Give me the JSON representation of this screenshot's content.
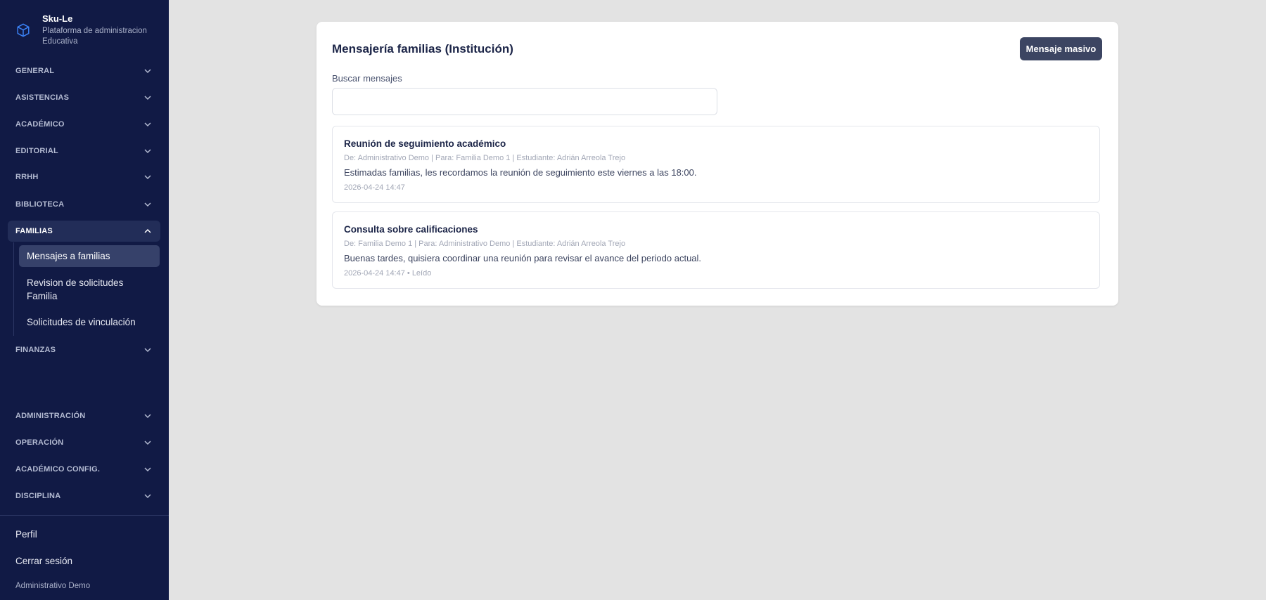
{
  "brand": {
    "title": "Sku-Le",
    "subtitle": "Plataforma de administracion Educativa",
    "icon": "cube-icon"
  },
  "sidebar": {
    "sections": [
      {
        "label": "GENERAL",
        "expanded": false
      },
      {
        "label": "ASISTENCIAS",
        "expanded": false
      },
      {
        "label": "ACADÉMICO",
        "expanded": false
      },
      {
        "label": "EDITORIAL",
        "expanded": false
      },
      {
        "label": "RRHH",
        "expanded": false
      },
      {
        "label": "BIBLIOTECA",
        "expanded": false
      },
      {
        "label": "FAMILIAS",
        "expanded": true
      },
      {
        "label": "FINANZAS",
        "expanded": false
      },
      {
        "label": "ADMINISTRACIÓN",
        "expanded": false
      },
      {
        "label": "OPERACIÓN",
        "expanded": false
      },
      {
        "label": "ACADÉMICO CONFIG.",
        "expanded": false
      },
      {
        "label": "DISCIPLINA",
        "expanded": false
      }
    ],
    "familias_items": [
      {
        "label": "Mensajes a familias",
        "active": true
      },
      {
        "label": "Revision de solicitudes Familia",
        "active": false
      },
      {
        "label": "Solicitudes de vinculación",
        "active": false
      }
    ],
    "footer": {
      "profile": "Perfil",
      "logout": "Cerrar sesión",
      "user": "Administrativo Demo"
    }
  },
  "main": {
    "title": "Mensajería familias (Institución)",
    "mass_button": "Mensaje masivo",
    "search_label": "Buscar mensajes",
    "search_value": "",
    "search_placeholder": "",
    "messages": [
      {
        "subject": "Reunión de seguimiento académico",
        "meta": "De: Administrativo Demo | Para: Familia Demo 1 | Estudiante: Adrián Arreola Trejo",
        "body": "Estimadas familias, les recordamos la reunión de seguimiento este viernes a las 18:00.",
        "time": "2026-04-24 14:47"
      },
      {
        "subject": "Consulta sobre calificaciones",
        "meta": "De: Familia Demo 1 | Para: Administrativo Demo | Estudiante: Adrián Arreola Trejo",
        "body": "Buenas tardes, quisiera coordinar una reunión para revisar el avance del periodo actual.",
        "time": "2026-04-24 14:47 • Leído"
      }
    ]
  },
  "colors": {
    "sidebar_bg": "#111a45",
    "accent_icon": "#3b82f6",
    "button_bg": "#3c4562",
    "page_bg": "#e3e3e3"
  }
}
